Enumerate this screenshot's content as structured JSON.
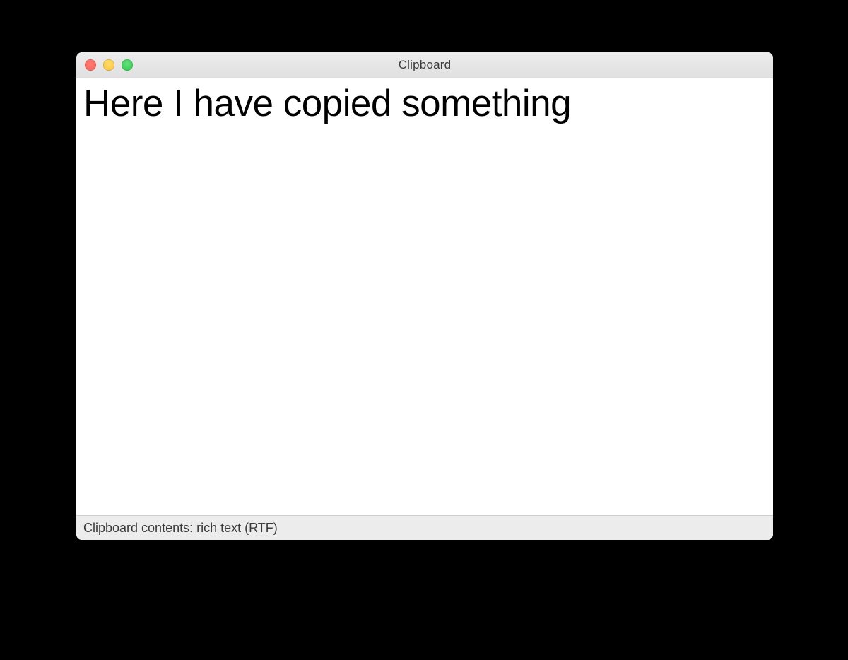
{
  "window": {
    "title": "Clipboard"
  },
  "content": {
    "clipboard_text": "Here I have copied something"
  },
  "status": {
    "label": "Clipboard contents: rich text (RTF)"
  }
}
